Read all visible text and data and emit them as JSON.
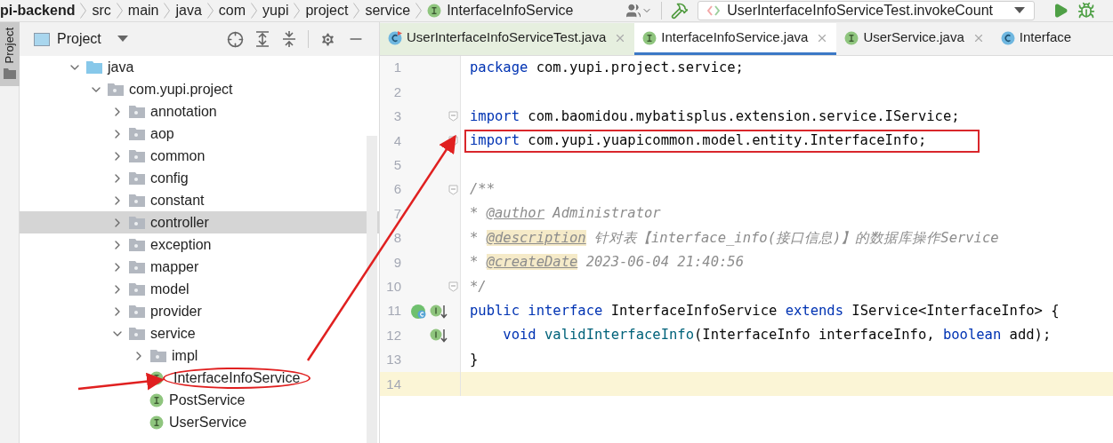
{
  "breadcrumb": [
    {
      "label": "pi-backend",
      "kind": "project"
    },
    {
      "label": "src",
      "kind": "folder"
    },
    {
      "label": "main",
      "kind": "folder"
    },
    {
      "label": "java",
      "kind": "folder"
    },
    {
      "label": "com",
      "kind": "folder"
    },
    {
      "label": "yupi",
      "kind": "folder"
    },
    {
      "label": "project",
      "kind": "folder"
    },
    {
      "label": "service",
      "kind": "folder"
    },
    {
      "label": "InterfaceInfoService",
      "kind": "interface"
    }
  ],
  "run_config": {
    "value": "UserInterfaceInfoServiceTest.invokeCount"
  },
  "side_strip": {
    "label": "Project"
  },
  "project_panel": {
    "title": "Project",
    "tree": [
      {
        "label": "java",
        "kind": "source-root",
        "expanded": true,
        "selected": false,
        "circled": false,
        "children": [
          {
            "label": "com.yupi.project",
            "kind": "package",
            "expanded": true,
            "selected": false,
            "circled": false,
            "children": [
              {
                "label": "annotation",
                "kind": "package",
                "expanded": false,
                "selected": false,
                "circled": false
              },
              {
                "label": "aop",
                "kind": "package",
                "expanded": false,
                "selected": false,
                "circled": false
              },
              {
                "label": "common",
                "kind": "package",
                "expanded": false,
                "selected": false,
                "circled": false
              },
              {
                "label": "config",
                "kind": "package",
                "expanded": false,
                "selected": false,
                "circled": false
              },
              {
                "label": "constant",
                "kind": "package",
                "expanded": false,
                "selected": false,
                "circled": false
              },
              {
                "label": "controller",
                "kind": "package",
                "expanded": false,
                "selected": true,
                "circled": false
              },
              {
                "label": "exception",
                "kind": "package",
                "expanded": false,
                "selected": false,
                "circled": false
              },
              {
                "label": "mapper",
                "kind": "package",
                "expanded": false,
                "selected": false,
                "circled": false
              },
              {
                "label": "model",
                "kind": "package",
                "expanded": false,
                "selected": false,
                "circled": false
              },
              {
                "label": "provider",
                "kind": "package",
                "expanded": false,
                "selected": false,
                "circled": false
              },
              {
                "label": "service",
                "kind": "package",
                "expanded": true,
                "selected": false,
                "circled": false,
                "children": [
                  {
                    "label": "impl",
                    "kind": "package",
                    "expanded": false,
                    "selected": false,
                    "circled": false
                  },
                  {
                    "label": "InterfaceInfoService",
                    "kind": "interface",
                    "selected": false,
                    "circled": true
                  },
                  {
                    "label": "PostService",
                    "kind": "interface",
                    "selected": false,
                    "circled": false
                  },
                  {
                    "label": "UserService",
                    "kind": "interface",
                    "selected": false,
                    "circled": false
                  }
                ]
              }
            ]
          }
        ]
      }
    ]
  },
  "tabs": [
    {
      "label": "UserInterfaceInfoServiceTest.java",
      "kind": "test-class",
      "selected": false
    },
    {
      "label": "InterfaceInfoService.java",
      "kind": "interface",
      "selected": true
    },
    {
      "label": "UserService.java",
      "kind": "interface",
      "selected": false
    },
    {
      "label": "Interface",
      "kind": "class",
      "selected": false
    }
  ],
  "editor": {
    "lines": [
      {
        "number": "1",
        "fold": false,
        "implemented": false,
        "subclassed": false,
        "current": false,
        "boxed": false,
        "segments": [
          {
            "text": "package",
            "kind": "keyword"
          },
          {
            "text": " com.yupi.project.service;",
            "kind": "plain"
          }
        ]
      },
      {
        "number": "2",
        "fold": false,
        "implemented": false,
        "subclassed": false,
        "current": false,
        "boxed": false
      },
      {
        "number": "3",
        "fold": true,
        "implemented": false,
        "subclassed": false,
        "current": false,
        "boxed": false,
        "segments": [
          {
            "text": "import",
            "kind": "keyword"
          },
          {
            "text": " com.baomidou.mybatisplus.extension.service.IService;",
            "kind": "plain"
          }
        ]
      },
      {
        "number": "4",
        "fold": true,
        "implemented": false,
        "subclassed": false,
        "current": false,
        "boxed": true,
        "segments": [
          {
            "text": "import",
            "kind": "keyword"
          },
          {
            "text": " com.yupi.yuapicommon.model.entity.InterfaceInfo;",
            "kind": "plain"
          }
        ]
      },
      {
        "number": "5",
        "fold": false,
        "implemented": false,
        "subclassed": false,
        "current": false,
        "boxed": false
      },
      {
        "number": "6",
        "fold": true,
        "implemented": false,
        "subclassed": false,
        "current": false,
        "boxed": false,
        "segments": [
          {
            "text": "/**",
            "kind": "comment"
          }
        ]
      },
      {
        "number": "7",
        "fold": false,
        "implemented": false,
        "subclassed": false,
        "current": false,
        "boxed": false,
        "segments": [
          {
            "text": "* ",
            "kind": "comment"
          },
          {
            "text": "@author",
            "kind": "doc-tag"
          },
          {
            "text": " Administrator",
            "kind": "comment"
          }
        ]
      },
      {
        "number": "8",
        "fold": false,
        "implemented": false,
        "subclassed": false,
        "current": false,
        "boxed": false,
        "segments": [
          {
            "text": "* ",
            "kind": "comment"
          },
          {
            "text": "@description",
            "kind": "doc-tag-marked"
          },
          {
            "text": " 针对表【interface_info(接口信息)】的数据库操作Service",
            "kind": "comment"
          }
        ]
      },
      {
        "number": "9",
        "fold": false,
        "implemented": false,
        "subclassed": false,
        "current": false,
        "boxed": false,
        "segments": [
          {
            "text": "* ",
            "kind": "comment"
          },
          {
            "text": "@createDate",
            "kind": "doc-tag-marked"
          },
          {
            "text": " 2023-06-04 21:40:56",
            "kind": "comment"
          }
        ]
      },
      {
        "number": "10",
        "fold": true,
        "implemented": false,
        "subclassed": false,
        "current": false,
        "boxed": false,
        "segments": [
          {
            "text": "*/",
            "kind": "comment"
          }
        ]
      },
      {
        "number": "11",
        "fold": false,
        "implemented": true,
        "subclassed": true,
        "current": false,
        "boxed": false,
        "segments": [
          {
            "text": "public",
            "kind": "keyword"
          },
          {
            "text": " interface",
            "kind": "keyword"
          },
          {
            "text": " InterfaceInfoService ",
            "kind": "plain"
          },
          {
            "text": "extends",
            "kind": "keyword"
          },
          {
            "text": " IService<InterfaceInfo> {",
            "kind": "plain"
          }
        ]
      },
      {
        "number": "12",
        "fold": false,
        "implemented": true,
        "subclassed": false,
        "current": false,
        "boxed": false,
        "segments": [
          {
            "text": "    void",
            "kind": "keyword"
          },
          {
            "text": " validInterfaceInfo",
            "kind": "method"
          },
          {
            "text": "(InterfaceInfo interfaceInfo, ",
            "kind": "plain"
          },
          {
            "text": "boolean",
            "kind": "keyword"
          },
          {
            "text": " add);",
            "kind": "plain"
          }
        ]
      },
      {
        "number": "13",
        "fold": false,
        "implemented": false,
        "subclassed": false,
        "current": false,
        "boxed": false,
        "segments": [
          {
            "text": "}",
            "kind": "plain"
          }
        ]
      },
      {
        "number": "14",
        "fold": false,
        "implemented": false,
        "subclassed": false,
        "current": true,
        "boxed": false
      }
    ]
  }
}
